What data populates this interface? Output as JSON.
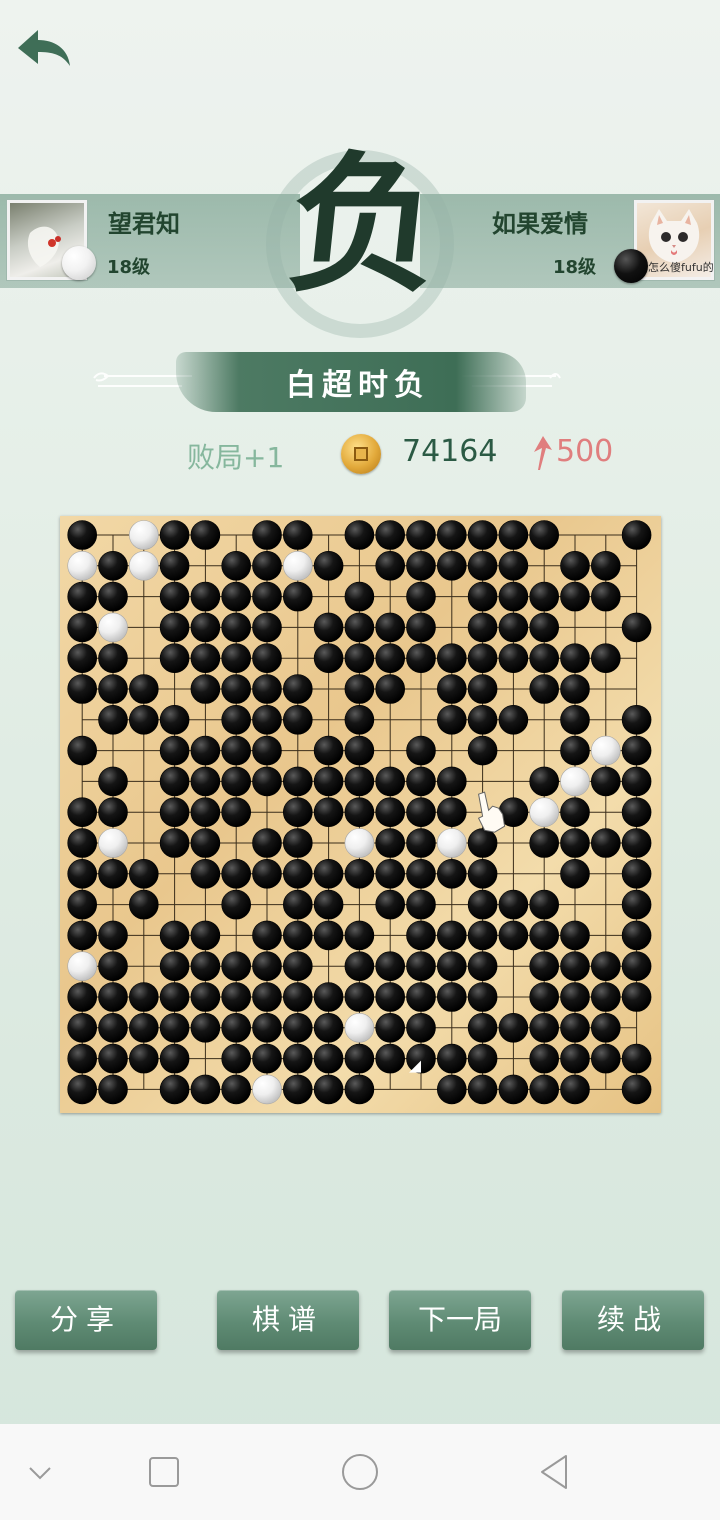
{
  "header": {
    "back_icon": "back-arrow-icon"
  },
  "result": {
    "char": "负",
    "reason": "白超时负"
  },
  "players": {
    "left": {
      "name": "望君知",
      "level": "18级",
      "stone": "white"
    },
    "right": {
      "name": "如果爱情",
      "level": "18级",
      "stone": "black",
      "avatar_caption": "怎么傻fufu的"
    }
  },
  "stats": {
    "loss_label": "败局+1",
    "coins": "74164",
    "rank_change": "500"
  },
  "board": {
    "size": 19,
    "rows": [
      "B.WBB.BB.BBBBBBB..B",
      "WBWB.BBWB.BBBBB.BB.",
      "BB.BBBBB.B.B.BBBBB.",
      "BW.BBBB.BBBB.BBB..B",
      "BB.BBBB.BBBBBBBBBB.",
      "BBB.BBBB.BB.BB.BB..",
      ".BBB.BBB.B..BBB.B.B",
      "B..BBBB.BB.B.B..BWB",
      ".B.BBBBBBBBBB..BWBB",
      "BB.BBB.BBBBBB.BWB.B",
      "BW.BB.BB.WBBWB.BBBB",
      "BBB.BBBBBBBBBB..B.B",
      "B.B..B.BB.BB.BBB..B",
      "BB.BB.BBBB.BBBBBB.B",
      "WB.BBBBB.BBBBB.BBBB",
      "BBBBBBBBBBBBBB.BBBB",
      "BBBBBBBBBWBB.BBBBB.",
      "BBBB.BBBBBBBBB.BBBB",
      "BB.BBBWBBB..BBBBB.B"
    ],
    "last_move_marker": "corner-triangle",
    "hand_icon": "pointing-hand-icon"
  },
  "buttons": {
    "share": "分享",
    "record": "棋谱",
    "next": "下一局",
    "continue": "续战"
  },
  "navbar": [
    "chevron-down-icon",
    "square-icon",
    "circle-icon",
    "triangle-back-icon"
  ],
  "colors": {
    "accent": "#4f7a63",
    "board": "#e9c78d",
    "rank_up": "#e07e7e"
  }
}
